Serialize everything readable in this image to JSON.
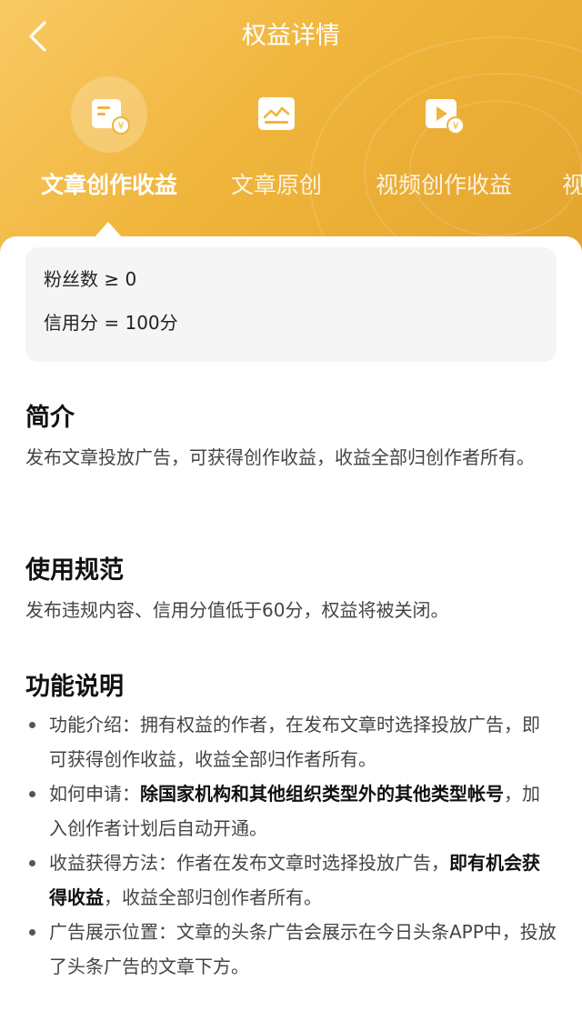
{
  "header": {
    "title": "权益详情",
    "tabs": [
      {
        "label": "文章创作收益",
        "icon": "article-income-icon",
        "active": true
      },
      {
        "label": "文章原创",
        "icon": "original-chart-icon",
        "active": false
      },
      {
        "label": "视频创作收益",
        "icon": "video-income-icon",
        "active": false
      },
      {
        "label": "视",
        "icon": "",
        "active": false
      }
    ]
  },
  "requirements": {
    "fans": "粉丝数 ≥ 0",
    "credit": "信用分 = 100分"
  },
  "intro": {
    "title": "简介",
    "text": "发布文章投放广告，可获得创作收益，收益全部归创作者所有。"
  },
  "rules": {
    "title": "使用规范",
    "text": "发布违规内容、信用分值低于60分，权益将被关闭。"
  },
  "features": {
    "title": "功能说明",
    "items": [
      {
        "pre": "功能介绍：拥有权益的作者，在发布文章时选择投放广告，即可获得创作收益，收益全部归作者所有。",
        "bold": "",
        "post": ""
      },
      {
        "pre": "如何申请：",
        "bold": "除国家机构和其他组织类型外的其他类型帐号",
        "post": "，加入创作者计划后自动开通。"
      },
      {
        "pre": "收益获得方法：作者在发布文章时选择投放广告，",
        "bold": "即有机会获得收益",
        "post": "，收益全部归创作者所有。"
      },
      {
        "pre": "广告展示位置：文章的头条广告会展示在今日头条APP中，投放了头条广告的文章下方。",
        "bold": "",
        "post": ""
      }
    ]
  },
  "colors": {
    "header_start": "#f9c964",
    "header_end": "#e3a52e",
    "card_bg": "#f5f5f5"
  }
}
